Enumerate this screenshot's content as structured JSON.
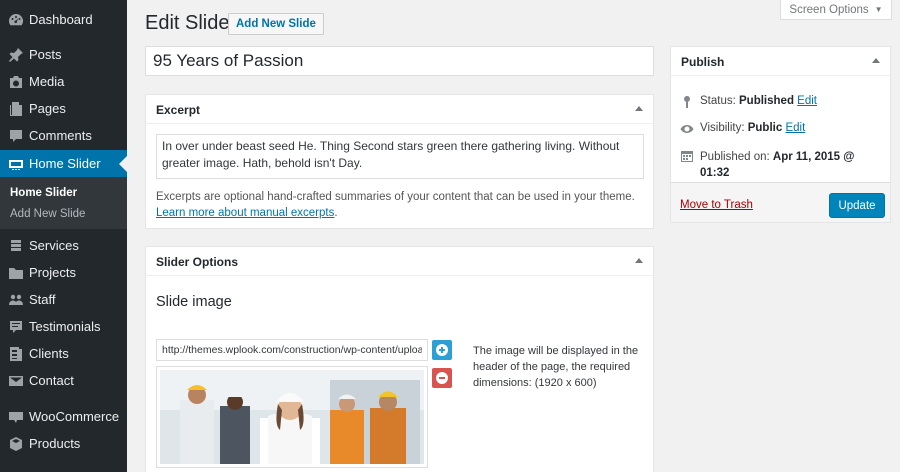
{
  "sidebar": {
    "items": [
      {
        "label": "Dashboard",
        "icon": "dashboard-icon"
      },
      {
        "label": "Posts",
        "icon": "pin-icon"
      },
      {
        "label": "Media",
        "icon": "media-icon"
      },
      {
        "label": "Pages",
        "icon": "pages-icon"
      },
      {
        "label": "Comments",
        "icon": "comments-icon"
      },
      {
        "label": "Home Slider",
        "icon": "slider-icon",
        "active": true
      },
      {
        "label": "Services",
        "icon": "services-icon"
      },
      {
        "label": "Projects",
        "icon": "folder-icon"
      },
      {
        "label": "Staff",
        "icon": "staff-icon"
      },
      {
        "label": "Testimonials",
        "icon": "testimonials-icon"
      },
      {
        "label": "Clients",
        "icon": "clients-icon"
      },
      {
        "label": "Contact",
        "icon": "contact-icon"
      },
      {
        "label": "WooCommerce",
        "icon": "woocommerce-icon"
      },
      {
        "label": "Products",
        "icon": "products-icon"
      }
    ],
    "submenu": [
      {
        "label": "Home Slider",
        "current": true
      },
      {
        "label": "Add New Slide",
        "current": false
      }
    ]
  },
  "header": {
    "title": "Edit Slide",
    "add_new_label": "Add New Slide",
    "screen_options_label": "Screen Options"
  },
  "post": {
    "title_value": "95 Years of Passion"
  },
  "excerpt": {
    "heading": "Excerpt",
    "text": "In over under beast seed He. Thing Second stars green there gathering living. Without greater image. Hath, behold isn't Day.",
    "help_text": "Excerpts are optional hand-crafted summaries of your content that can be used in your theme.",
    "help_link": "Learn more about manual excerpts",
    "help_end": "."
  },
  "slider_options": {
    "heading": "Slider Options",
    "slide_image_heading": "Slide image",
    "image_url": "http://themes.wplook.com/construction/wp-content/uploads",
    "image_description": "The image will be displayed in the header of the page, the required dimensions: (1920 x 600)"
  },
  "publish": {
    "heading": "Publish",
    "status_label": "Status:",
    "status_value": "Published",
    "visibility_label": "Visibility:",
    "visibility_value": "Public",
    "published_label": "Published on:",
    "published_value": "Apr 11, 2015 @ 01:32",
    "edit_label": "Edit",
    "trash_label": "Move to Trash",
    "update_label": "Update"
  },
  "colors": {
    "sidebar_bg": "#23282d",
    "accent": "#0073aa",
    "primary_button": "#0085ba",
    "trash_red": "#a00",
    "add_button": "#2e9fd2",
    "remove_button": "#d9534f"
  }
}
